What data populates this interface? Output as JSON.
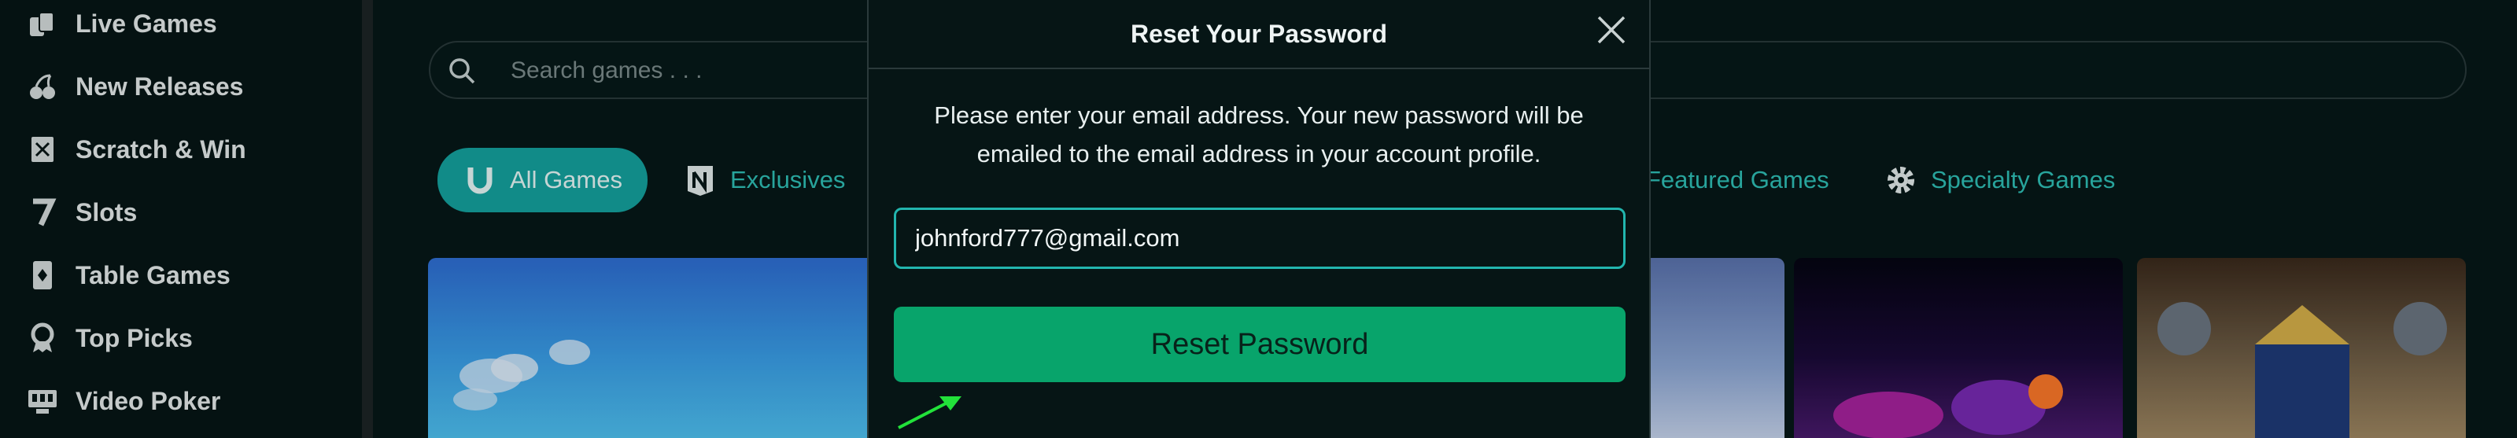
{
  "sidebar": {
    "items": [
      {
        "label": "Live Games",
        "icon": "cards-icon"
      },
      {
        "label": "New Releases",
        "icon": "cherry-icon"
      },
      {
        "label": "Scratch & Win",
        "icon": "scratch-ticket-icon"
      },
      {
        "label": "Slots",
        "icon": "seven-icon"
      },
      {
        "label": "Table Games",
        "icon": "playing-card-icon"
      },
      {
        "label": "Top Picks",
        "icon": "award-icon"
      },
      {
        "label": "Video Poker",
        "icon": "video-poker-icon"
      }
    ]
  },
  "search": {
    "placeholder": "Search games . . ."
  },
  "categories": [
    {
      "label": "All Games",
      "icon": "horseshoe-icon",
      "active": true
    },
    {
      "label": "Exclusives",
      "icon": "exclusives-icon",
      "active": false
    },
    {
      "label": "Featured Games",
      "icon": "",
      "active": false
    },
    {
      "label": "Specialty Games",
      "icon": "gear-icon",
      "active": false
    }
  ],
  "modal": {
    "title": "Reset Your Password",
    "message": "Please enter your email address. Your new password will be emailed to the email address in your account profile.",
    "email_value": "johnford777@gmail.com",
    "button_label": "Reset Password"
  },
  "colors": {
    "accent": "#14a4a0",
    "button": "#08a46b",
    "background": "#061616"
  }
}
